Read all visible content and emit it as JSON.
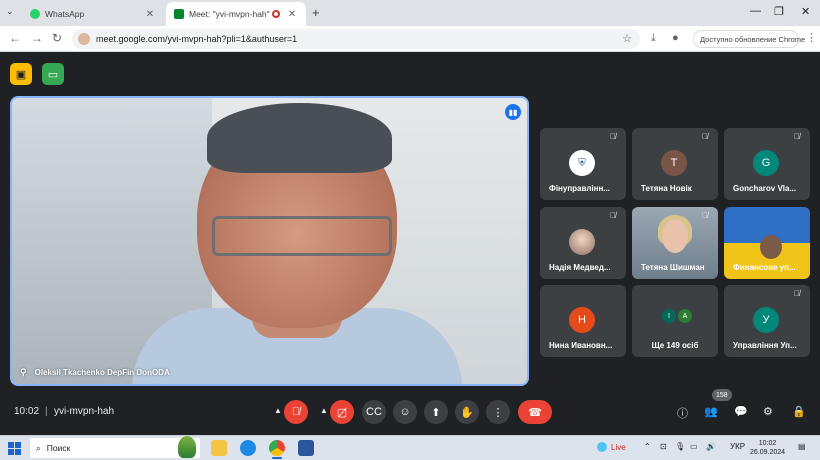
{
  "browser": {
    "tabs": [
      {
        "title": "WhatsApp",
        "favicon": "whatsapp-icon",
        "color": "#25d366"
      },
      {
        "title": "Meet: \"yvi-mvpn-hah\"",
        "favicon": "meet-icon",
        "color": "#00832d",
        "active": true,
        "recording": true
      }
    ],
    "url": "meet.google.com/yvi-mvpn-hah?pli=1&authuser=1",
    "update_button": "Доступно обновление Chrome"
  },
  "meeting": {
    "main_speaker": "Oleksil Tkachenko DepFin DonODA",
    "time": "10:02",
    "separator": "|",
    "code": "yvi-mvpn-hah",
    "participant_count": "158"
  },
  "participants": [
    {
      "name": "Фінуправлінн...",
      "avatar": "emblem",
      "avatar_color": "#ffffff",
      "muted": true
    },
    {
      "name": "Тетяна Новік",
      "avatar": "Т",
      "avatar_color": "#795548",
      "muted": true
    },
    {
      "name": "Goncharov Vla...",
      "avatar": "G",
      "avatar_color": "#00897b",
      "muted": true
    },
    {
      "name": "Надія Медвед...",
      "avatar": "photo",
      "avatar_color": "#c8a88f",
      "muted": true
    },
    {
      "name": "Тетяна Шишман",
      "avatar": "video",
      "avatar_color": "#8a9aa7",
      "muted": true
    },
    {
      "name": "Финансове уп...",
      "avatar": "video-flag",
      "avatar_color": "#2f6fc4",
      "muted": false
    },
    {
      "name": "Нина Ивановн...",
      "avatar": "Н",
      "avatar_color": "#e64a19",
      "muted": false
    },
    {
      "name": "Ще 149 осіб",
      "avatars": [
        "І",
        "А"
      ],
      "avatar_colors": [
        "#00695c",
        "#2e7d32"
      ],
      "muted": false
    },
    {
      "name": "Управління Уп...",
      "avatar": "У",
      "avatar_color": "#00897b",
      "muted": true
    }
  ],
  "taskbar": {
    "search_placeholder": "Поиск",
    "live_label": "Live",
    "language": "УКР",
    "clock_time": "10:02",
    "clock_date": "26.09.2024"
  },
  "colors": {
    "meet_bg": "#202124",
    "tile_bg": "#3c4043",
    "end_call": "#ea4335",
    "active_speaker_border": "#8ab4f8"
  }
}
